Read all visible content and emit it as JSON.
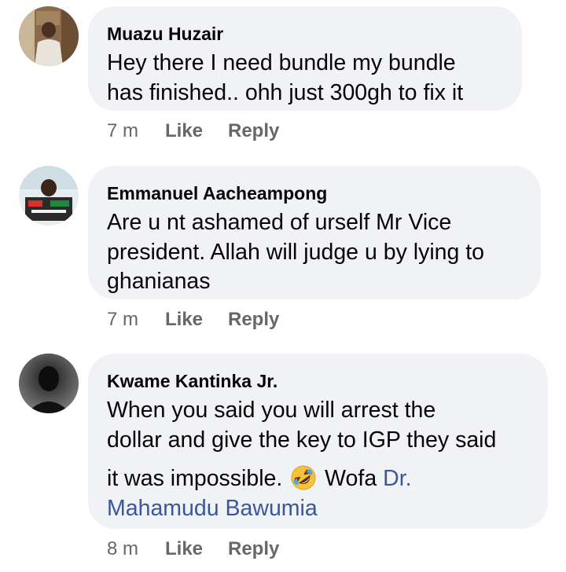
{
  "comments": [
    {
      "author": "Muazu Huzair",
      "lines": [
        "Hey there I need bundle my bundle",
        "has finished.. ohh just 300gh to fix it"
      ],
      "time": "7 m",
      "like_label": "Like",
      "reply_label": "Reply"
    },
    {
      "author": "Emmanuel Aacheampong",
      "lines": [
        "Are u nt ashamed of urself Mr Vice",
        "president. Allah will judge u by lying to",
        "ghanianas"
      ],
      "time": "7 m",
      "like_label": "Like",
      "reply_label": "Reply"
    },
    {
      "author": "Kwame Kantinka Jr.",
      "lines": [
        "When you said you will arrest the",
        "dollar and give the key to IGP they said"
      ],
      "line3_text": "it was impossible.",
      "emoji": "rolling-on-floor-laughing-emoji",
      "line3_after": "Wofa",
      "mention_part1": "Dr.",
      "mention_part2": "Mahamudu Bawumia",
      "time": "8 m",
      "like_label": "Like",
      "reply_label": "Reply"
    }
  ],
  "colors": {
    "bubble": "#f0f2f5",
    "text": "#050505",
    "meta": "#65676b",
    "link": "#385898"
  }
}
